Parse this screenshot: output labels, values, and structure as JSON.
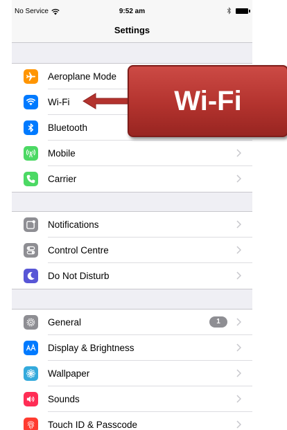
{
  "status_bar": {
    "carrier": "No Service",
    "time": "9:52 am"
  },
  "nav": {
    "title": "Settings"
  },
  "groups": [
    [
      {
        "label": "Aeroplane Mode",
        "icon": "airplane-icon",
        "color": "#ff9500"
      },
      {
        "label": "Wi-Fi",
        "icon": "wifi-icon",
        "color": "#007aff"
      },
      {
        "label": "Bluetooth",
        "icon": "bluetooth-icon",
        "color": "#007aff"
      },
      {
        "label": "Mobile",
        "icon": "cellular-antenna-icon",
        "color": "#4cd964"
      },
      {
        "label": "Carrier",
        "icon": "phone-icon",
        "color": "#4cd964"
      }
    ],
    [
      {
        "label": "Notifications",
        "icon": "notifications-icon",
        "color": "#8e8e93"
      },
      {
        "label": "Control Centre",
        "icon": "toggles-icon",
        "color": "#8e8e93"
      },
      {
        "label": "Do Not Disturb",
        "icon": "moon-icon",
        "color": "#5856d6"
      }
    ],
    [
      {
        "label": "General",
        "icon": "gear-icon",
        "color": "#8e8e93",
        "badge": "1"
      },
      {
        "label": "Display & Brightness",
        "icon": "text-size-icon",
        "color": "#007aff"
      },
      {
        "label": "Wallpaper",
        "icon": "flower-icon",
        "color": "#34aadc"
      },
      {
        "label": "Sounds",
        "icon": "speaker-icon",
        "color": "#ff2d55"
      },
      {
        "label": "Touch ID & Passcode",
        "icon": "fingerprint-icon",
        "color": "#ff3b30"
      }
    ]
  ],
  "callout": {
    "text": "Wi-Fi",
    "color": "#b3332e"
  }
}
